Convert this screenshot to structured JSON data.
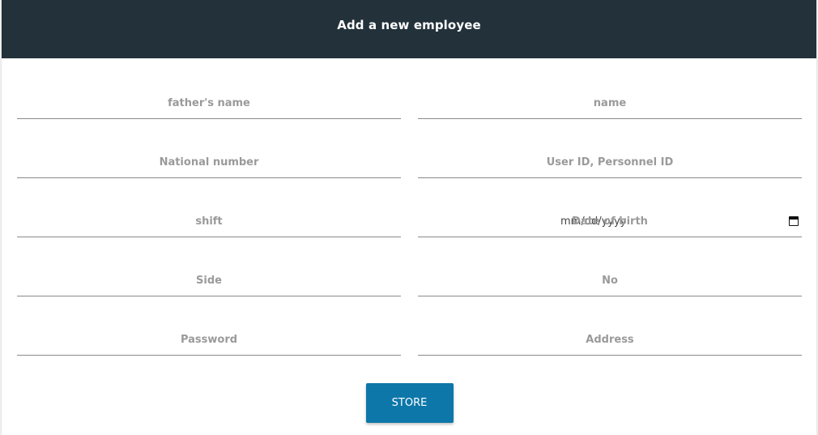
{
  "header": {
    "title": "Add a new employee"
  },
  "form": {
    "rows": [
      {
        "left": {
          "placeholder": "father's name",
          "value": ""
        },
        "right": {
          "placeholder": "name",
          "value": ""
        }
      },
      {
        "left": {
          "placeholder": "National number",
          "value": ""
        },
        "right": {
          "placeholder": "User ID, Personnel ID",
          "value": ""
        }
      },
      {
        "left": {
          "placeholder": "shift",
          "value": ""
        },
        "right": {
          "label": "Date of birth",
          "mask": "mm/dd/yyyy",
          "value": ""
        }
      },
      {
        "left": {
          "placeholder": "Side",
          "value": ""
        },
        "right": {
          "placeholder": "No",
          "value": ""
        }
      },
      {
        "left": {
          "placeholder": "Password",
          "value": ""
        },
        "right": {
          "placeholder": "Address",
          "value": ""
        }
      }
    ],
    "submit_label": "STORE"
  },
  "colors": {
    "header_bg": "#23313a",
    "button_bg": "#0d77a9",
    "placeholder": "#9a9a9a"
  },
  "icons": {
    "date_picker": "calendar-icon"
  }
}
